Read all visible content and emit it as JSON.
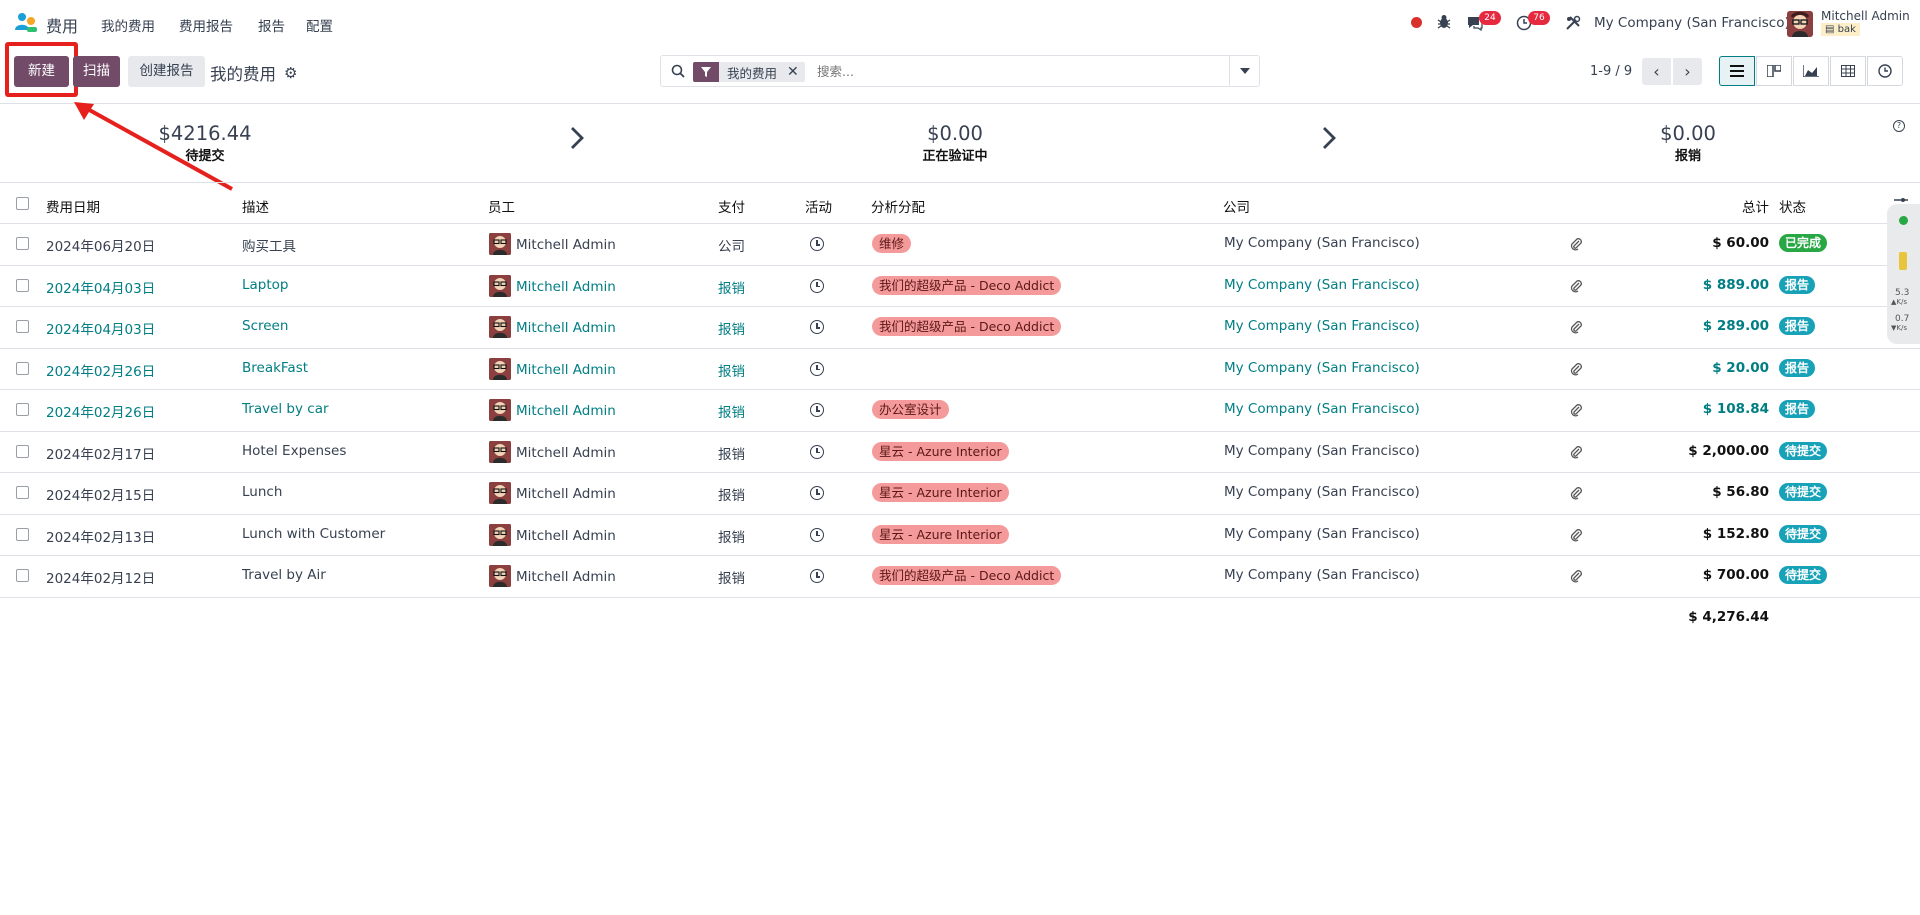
{
  "topnav": {
    "app_name": "费用",
    "menu": [
      "我的费用",
      "费用报告",
      "报告",
      "配置"
    ],
    "badge_chat": "24",
    "badge_activity": "76",
    "company": "My Company (San Francisco)",
    "user_name": "Mitchell Admin",
    "user_db": "bak"
  },
  "control": {
    "new_label": "新建",
    "scan_label": "扫描",
    "create_report_label": "创建报告",
    "title": "我的费用",
    "search_facet": "我的费用",
    "search_placeholder": "搜索...",
    "pager": "1-9 / 9"
  },
  "stats": [
    {
      "amount": "$4216.44",
      "label": "待提交"
    },
    {
      "amount": "$0.00",
      "label": "正在验证中"
    },
    {
      "amount": "$0.00",
      "label": "报销"
    }
  ],
  "table": {
    "headers": {
      "date": "费用日期",
      "desc": "描述",
      "employee": "员工",
      "payment": "支付",
      "activity": "活动",
      "analytic": "分析分配",
      "company": "公司",
      "total": "总计",
      "status": "状态"
    },
    "rows": [
      {
        "date": "2024年06月20日",
        "desc": "购买工具",
        "employee": "Mitchell Admin",
        "payment": "公司",
        "analytic": "维修",
        "company": "My Company (San Francisco)",
        "total": "$ 60.00",
        "status": "已完成",
        "status_color": "#28a745",
        "linked": false
      },
      {
        "date": "2024年04月03日",
        "desc": "Laptop",
        "employee": "Mitchell Admin",
        "payment": "报销",
        "analytic": "我们的超级产品 - Deco Addict",
        "company": "My Company (San Francisco)",
        "total": "$ 889.00",
        "status": "报告",
        "status_color": "#17a2b8",
        "linked": true
      },
      {
        "date": "2024年04月03日",
        "desc": "Screen",
        "employee": "Mitchell Admin",
        "payment": "报销",
        "analytic": "我们的超级产品 - Deco Addict",
        "company": "My Company (San Francisco)",
        "total": "$ 289.00",
        "status": "报告",
        "status_color": "#17a2b8",
        "linked": true
      },
      {
        "date": "2024年02月26日",
        "desc": "BreakFast",
        "employee": "Mitchell Admin",
        "payment": "报销",
        "analytic": "",
        "company": "My Company (San Francisco)",
        "total": "$ 20.00",
        "status": "报告",
        "status_color": "#17a2b8",
        "linked": true
      },
      {
        "date": "2024年02月26日",
        "desc": "Travel by car",
        "employee": "Mitchell Admin",
        "payment": "报销",
        "analytic": "办公室设计",
        "company": "My Company (San Francisco)",
        "total": "$ 108.84",
        "status": "报告",
        "status_color": "#17a2b8",
        "linked": true
      },
      {
        "date": "2024年02月17日",
        "desc": "Hotel Expenses",
        "employee": "Mitchell Admin",
        "payment": "报销",
        "analytic": "星云 - Azure Interior",
        "company": "My Company (San Francisco)",
        "total": "$ 2,000.00",
        "status": "待提交",
        "status_color": "#17a2b8",
        "linked": false
      },
      {
        "date": "2024年02月15日",
        "desc": "Lunch",
        "employee": "Mitchell Admin",
        "payment": "报销",
        "analytic": "星云 - Azure Interior",
        "company": "My Company (San Francisco)",
        "total": "$ 56.80",
        "status": "待提交",
        "status_color": "#17a2b8",
        "linked": false
      },
      {
        "date": "2024年02月13日",
        "desc": "Lunch with Customer",
        "employee": "Mitchell Admin",
        "payment": "报销",
        "analytic": "星云 - Azure Interior",
        "company": "My Company (San Francisco)",
        "total": "$ 152.80",
        "status": "待提交",
        "status_color": "#17a2b8",
        "linked": false
      },
      {
        "date": "2024年02月12日",
        "desc": "Travel by Air",
        "employee": "Mitchell Admin",
        "payment": "报销",
        "analytic": "我们的超级产品 - Deco Addict",
        "company": "My Company (San Francisco)",
        "total": "$ 700.00",
        "status": "待提交",
        "status_color": "#17a2b8",
        "linked": false
      }
    ],
    "grand_total": "$ 4,276.44"
  },
  "side_widget": {
    "up": "5.3",
    "up_unit": "K/s",
    "down": "0.7",
    "down_unit": "K/s"
  }
}
